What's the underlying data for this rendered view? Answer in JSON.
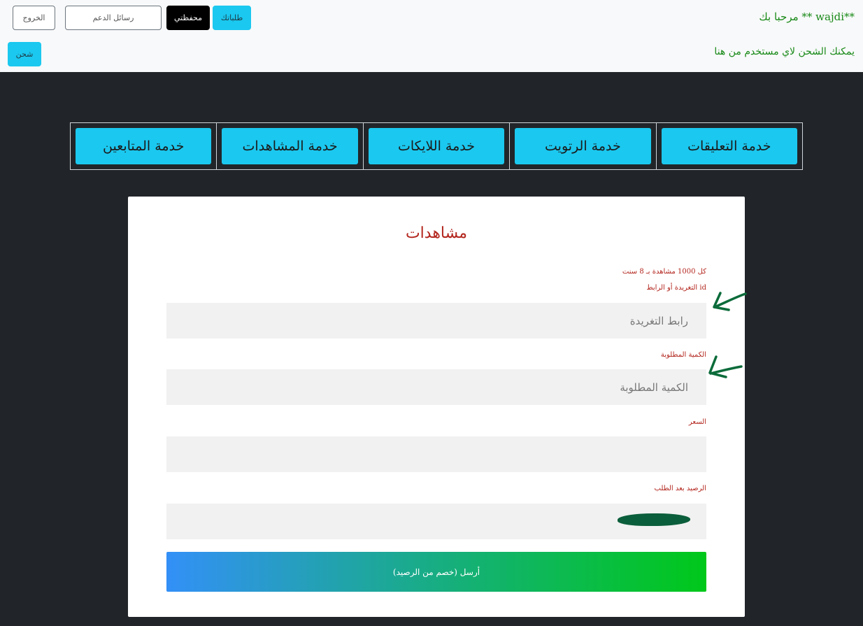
{
  "header": {
    "welcome": "مرحبا بك ** wajdi**",
    "charge_note": "يمكنك الشحن لاي مستخدم من هنا",
    "buttons": {
      "orders": "طلباتك",
      "wallet": "محفظتي",
      "support": "رسائل الدعم",
      "logout": "الخروج",
      "charge": "شحن"
    }
  },
  "services": [
    "خدمة التعليقات",
    "خدمة الرتويت",
    "خدمة اللايكات",
    "خدمة المشاهدات",
    "خدمة المتابعين"
  ],
  "form": {
    "title": "مشاهدات",
    "price_note": "كل 1000 مشاهدة بـ 8 سنت",
    "link_label": "id التغريدة أو الرابط",
    "link_placeholder": "رابط التغريدة",
    "quantity_label": "الكمية المطلوبة",
    "quantity_placeholder": "الكمية المطلوبة",
    "price_label": "السعر",
    "price_value": "",
    "balance_label": "الرصيد بعد الطلب",
    "submit_label": "أرسل (خصم من الرصيد)"
  },
  "colors": {
    "header_bg": "#f8f9fa",
    "page_bg": "#212529",
    "accent": "#1bc8ef",
    "welcome_text": "#198a19",
    "label_text": "#b3261e",
    "annotation_arrow": "#0b6b3a"
  }
}
